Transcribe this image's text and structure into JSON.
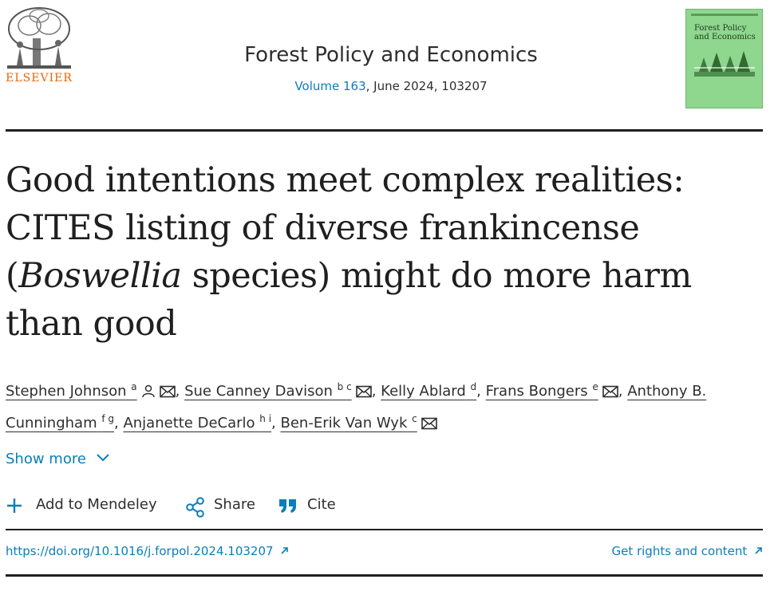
{
  "publisher": {
    "name": "ELSEVIER"
  },
  "journal": {
    "name": "Forest Policy and Economics",
    "volume_link": "Volume 163",
    "issue_info": ", June 2024, 103207",
    "cover_title": "Forest Policy and Economics"
  },
  "article": {
    "title_part1": "Good intentions meet complex realities: CITES listing of diverse frankincense (",
    "title_italic": "Boswellia",
    "title_part2": " species) might do more harm than good"
  },
  "authors": [
    {
      "name": "Stephen Johnson",
      "affil": "a",
      "icons": [
        "person-icon",
        "mail-icon"
      ]
    },
    {
      "name": "Sue Canney Davison",
      "affil": "b c",
      "icons": [
        "mail-icon"
      ]
    },
    {
      "name": "Kelly Ablard",
      "affil": "d",
      "icons": []
    },
    {
      "name": "Frans Bongers",
      "affil": "e",
      "icons": [
        "mail-icon"
      ]
    },
    {
      "name": "Anthony B. Cunningham",
      "affil": "f g",
      "icons": []
    },
    {
      "name": "Anjanette DeCarlo",
      "affil": "h i",
      "icons": []
    },
    {
      "name": "Ben-Erik Van Wyk",
      "affil": "c",
      "icons": [
        "mail-icon"
      ]
    }
  ],
  "show_more": "Show more",
  "actions": {
    "mendeley": "Add to Mendeley",
    "share": "Share",
    "cite": "Cite"
  },
  "doi": "https://doi.org/10.1016/j.forpol.2024.103207",
  "rights": "Get rights and content",
  "colors": {
    "link": "#0c7dbb",
    "elsevier_orange": "#eb6500",
    "cover_green": "#8fd68f"
  }
}
